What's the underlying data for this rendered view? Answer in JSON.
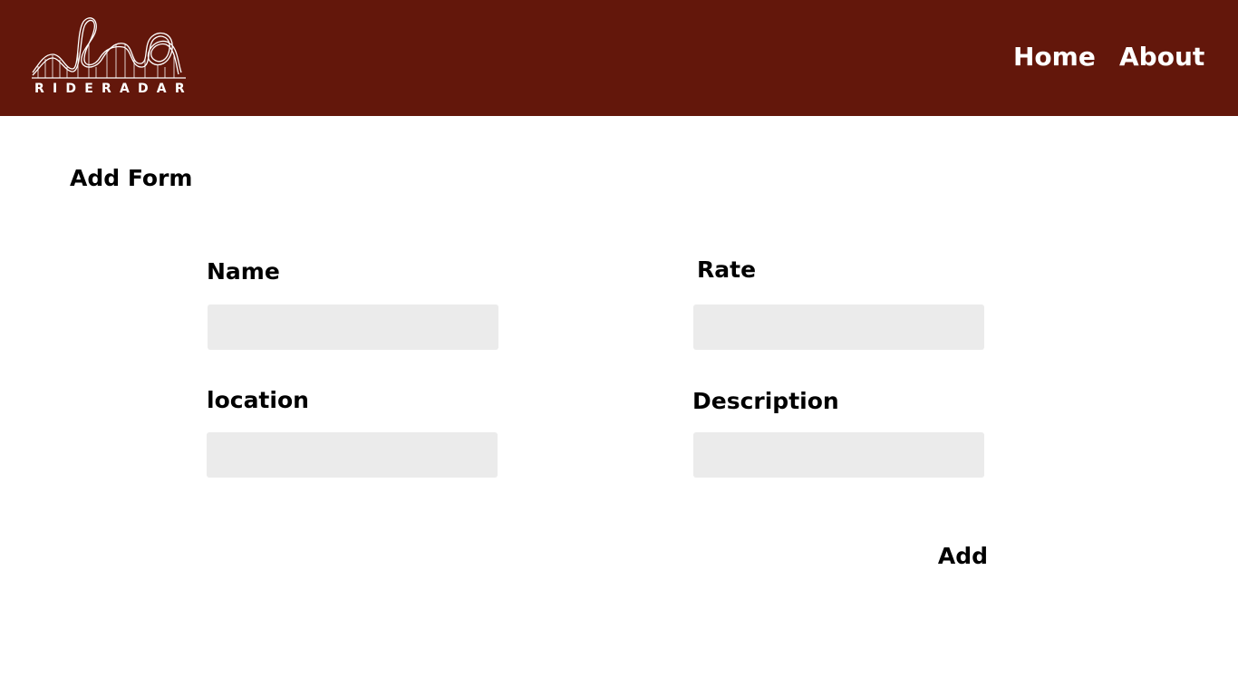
{
  "header": {
    "logo_text": "RIDERADAR",
    "logo_icon": "roller-coaster-icon",
    "background_color": "#63170b",
    "nav": [
      {
        "label": "Home"
      },
      {
        "label": "About"
      }
    ]
  },
  "form": {
    "title": "Add Form",
    "fields": {
      "name": {
        "label": "Name",
        "value": ""
      },
      "rate": {
        "label": "Rate",
        "value": ""
      },
      "location": {
        "label": "location",
        "value": ""
      },
      "description": {
        "label": "Description",
        "value": ""
      }
    },
    "submit_label": "Add",
    "input_background": "#ebebeb"
  }
}
